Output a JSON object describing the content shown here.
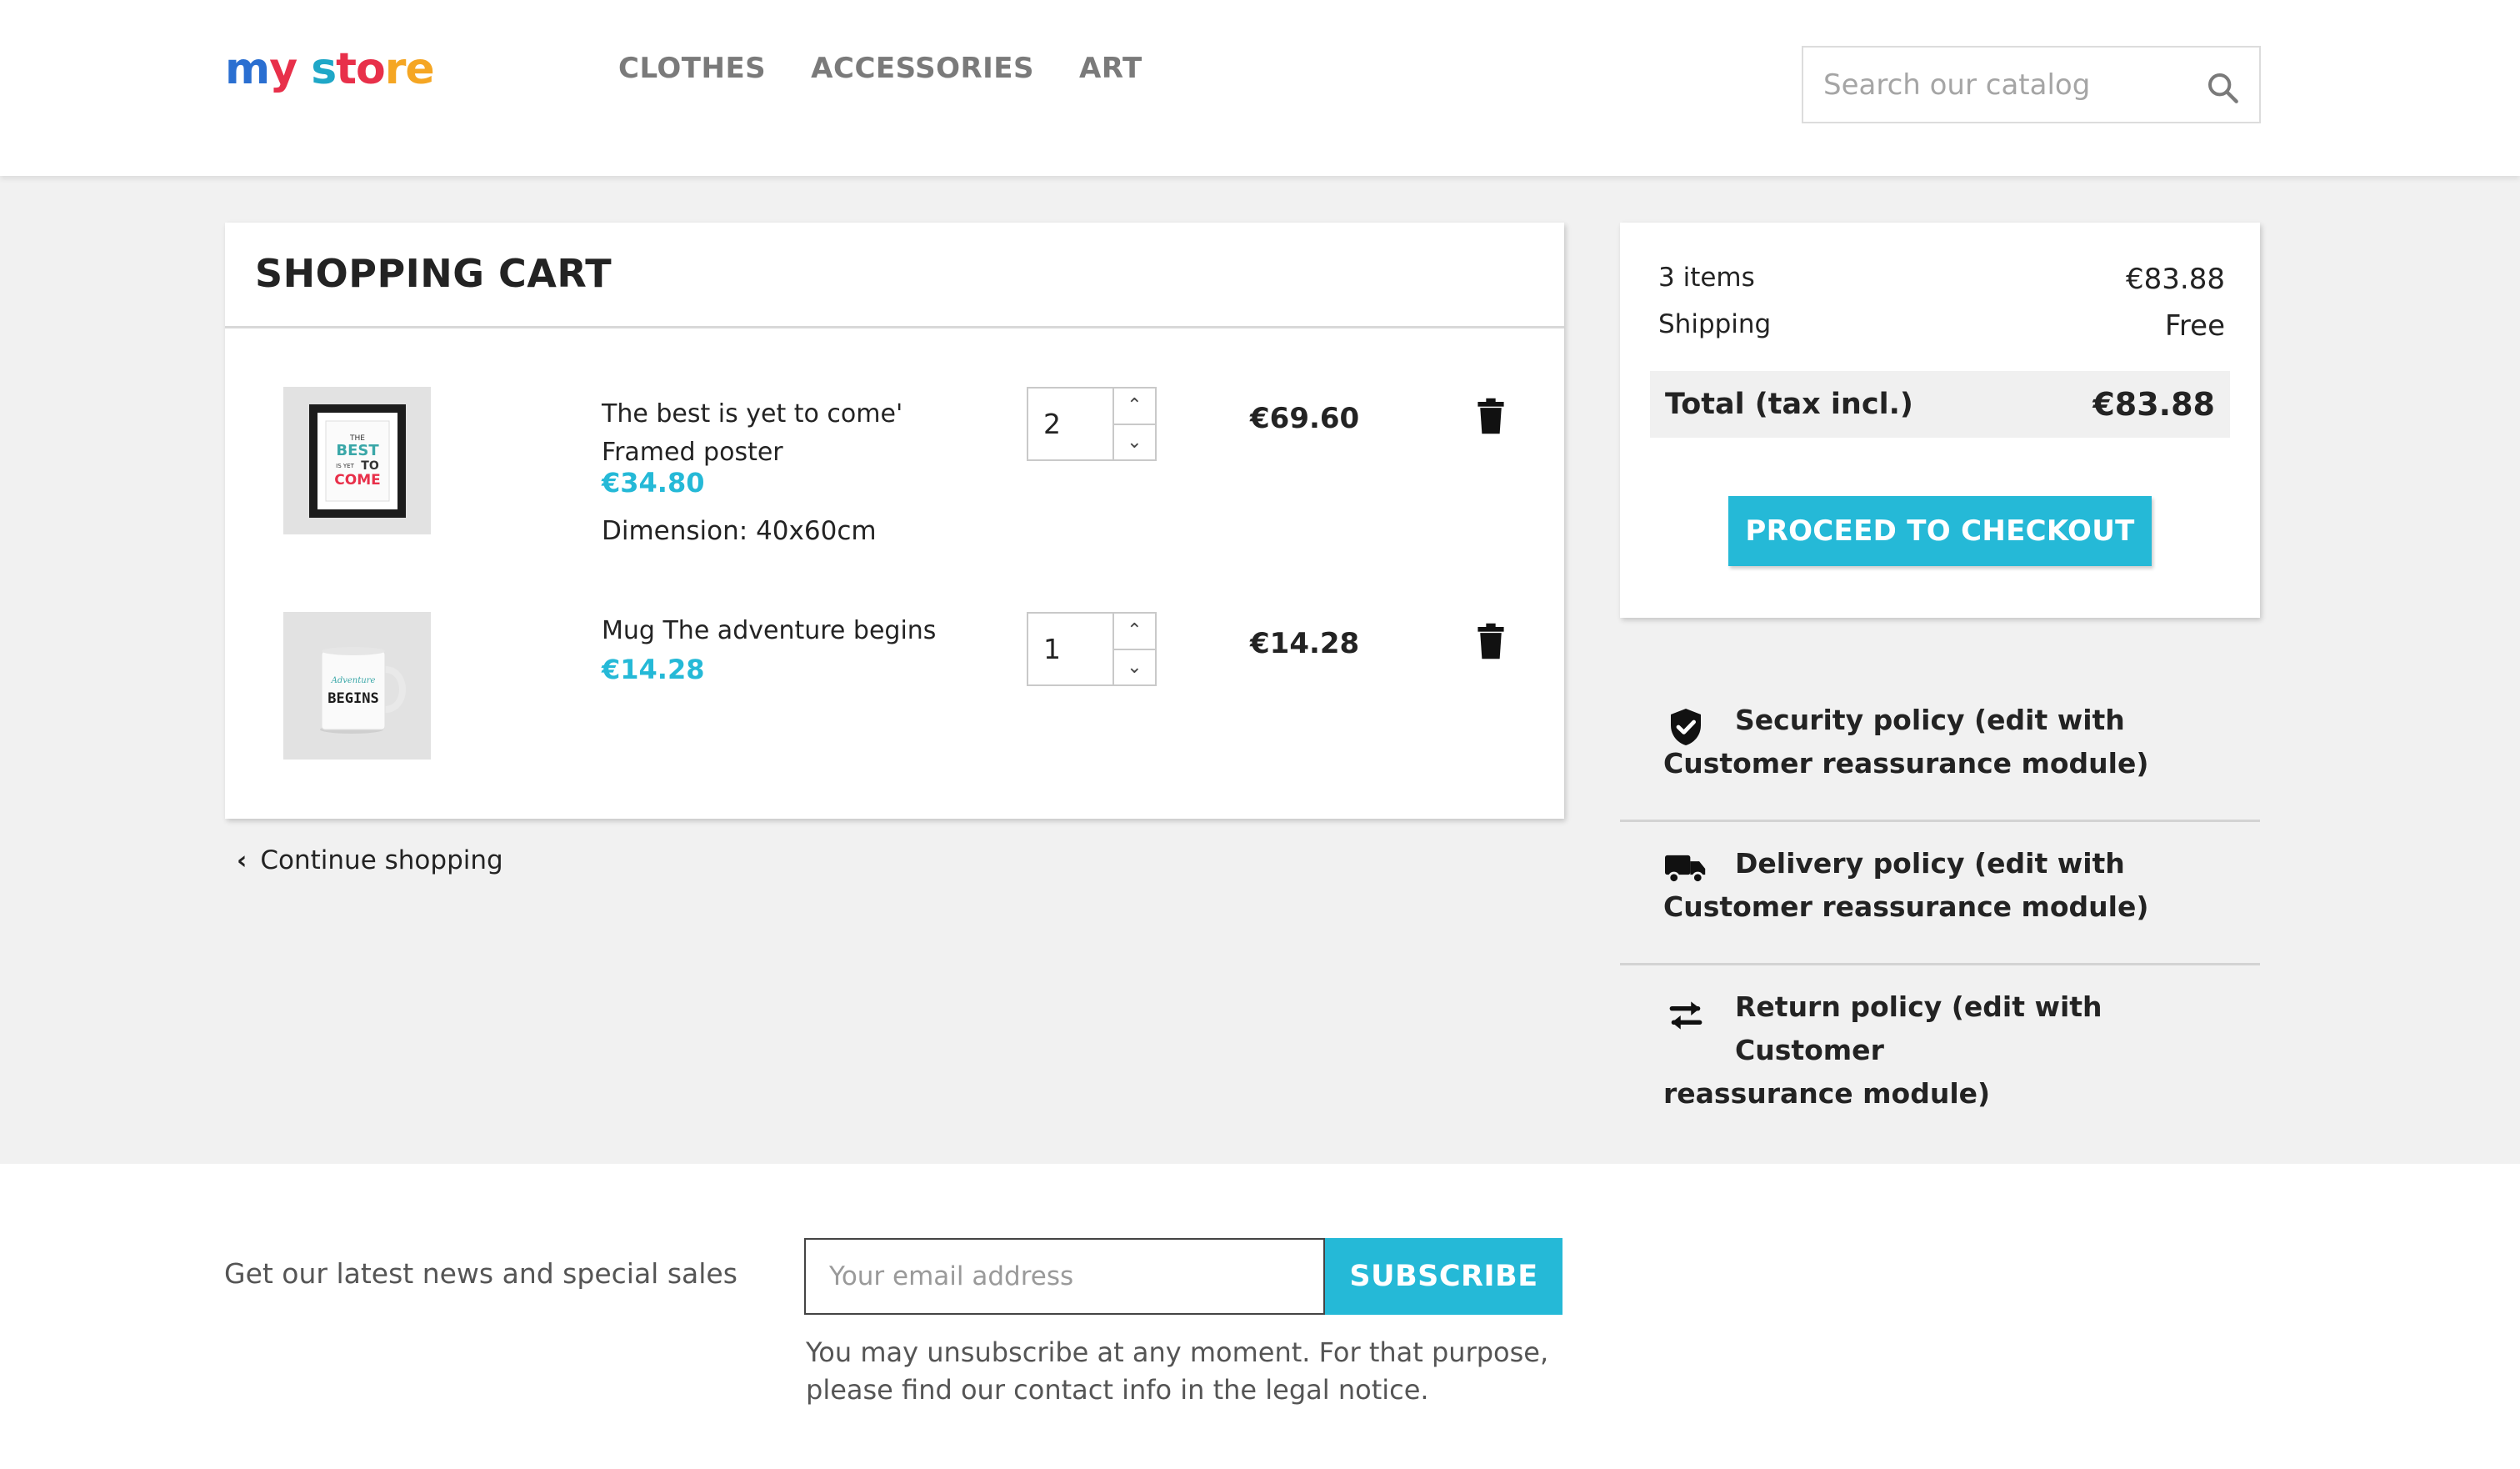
{
  "header": {
    "logo_parts": [
      "m",
      "y ",
      "s",
      "to",
      "re"
    ],
    "nav": [
      "CLOTHES",
      "ACCESSORIES",
      "ART"
    ],
    "search_placeholder": "Search our catalog"
  },
  "cart": {
    "title": "SHOPPING CART",
    "items": [
      {
        "name_line1": "The best is yet to come'",
        "name_line2": "Framed poster",
        "unit_price": "€34.80",
        "attribute": "Dimension: 40x60cm",
        "quantity": "2",
        "total": "€69.60",
        "image_text": [
          "THE",
          "BEST",
          "IS YET",
          "TO",
          "COME"
        ]
      },
      {
        "name_line1": "Mug The adventure begins",
        "name_line2": "",
        "unit_price": "€14.28",
        "attribute": "",
        "quantity": "1",
        "total": "€14.28",
        "image_text": [
          "Adventure",
          "BEGINS"
        ]
      }
    ],
    "continue_label": "Continue shopping"
  },
  "summary": {
    "items_label": "3 items",
    "items_value": "€83.88",
    "shipping_label": "Shipping",
    "shipping_value": "Free",
    "total_label": "Total (tax incl.)",
    "total_value": "€83.88",
    "checkout_label": "PROCEED TO CHECKOUT"
  },
  "reassurance": [
    {
      "icon": "shield-check-icon",
      "line1": "Security policy (edit with",
      "line2": "Customer reassurance module)"
    },
    {
      "icon": "truck-icon",
      "line1": "Delivery policy (edit with",
      "line2": "Customer reassurance module)"
    },
    {
      "icon": "swap-arrows-icon",
      "line1": "Return policy (edit with Customer",
      "line2": "reassurance module)"
    }
  ],
  "footer": {
    "newsletter_label": "Get our latest news and special sales",
    "email_placeholder": "Your email address",
    "subscribe_label": "SUBSCRIBE",
    "unsubscribe_line1": "You may unsubscribe at any moment. For that purpose,",
    "unsubscribe_line2": "please find our contact info in the legal notice."
  },
  "colors": {
    "accent": "#25b9d7",
    "background": "#f1f1f1",
    "text": "#232323"
  }
}
